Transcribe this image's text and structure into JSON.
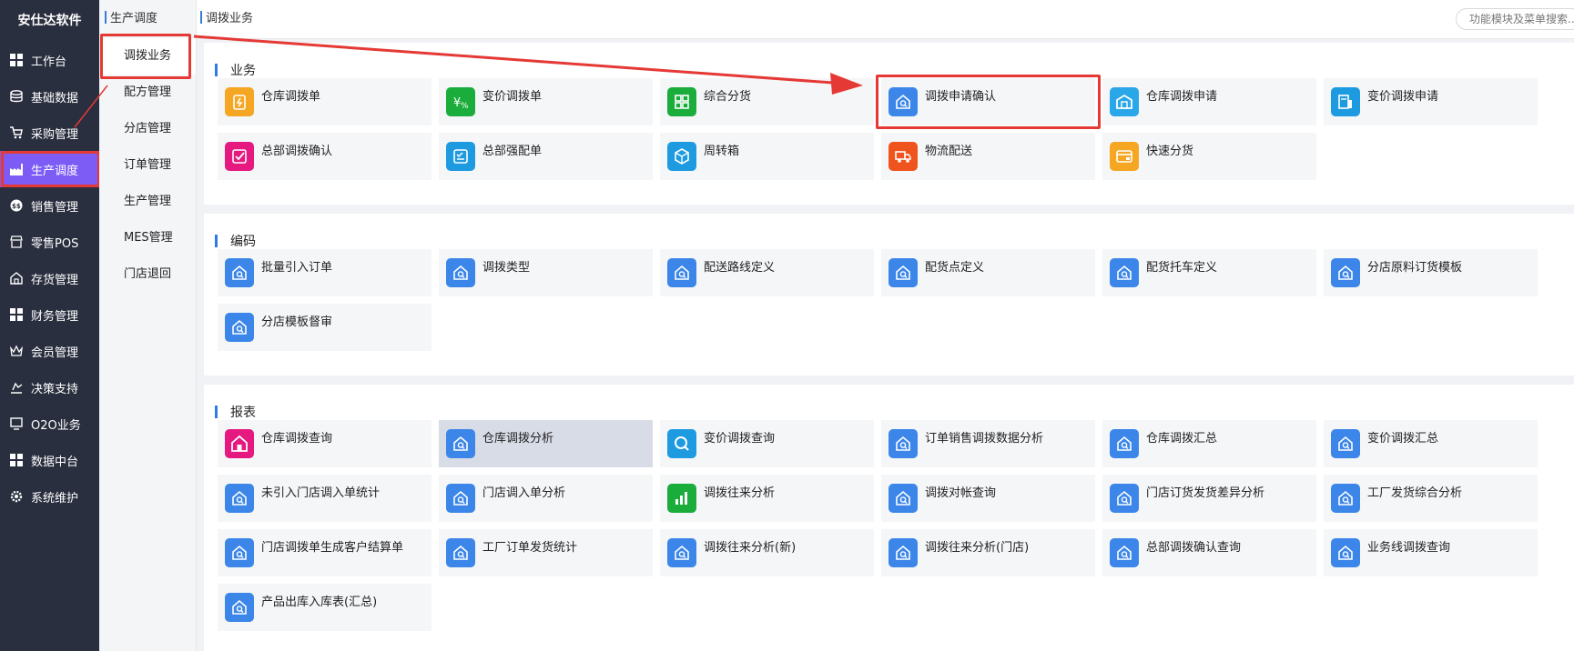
{
  "app": {
    "brand": "安仕达软件"
  },
  "sidebar": {
    "items": [
      {
        "label": "工作台",
        "icon": "grid-icon"
      },
      {
        "label": "基础数据",
        "icon": "database-icon"
      },
      {
        "label": "采购管理",
        "icon": "cart-icon"
      },
      {
        "label": "生产调度",
        "icon": "factory-icon",
        "active": true
      },
      {
        "label": "销售管理",
        "icon": "sales-icon"
      },
      {
        "label": "零售POS",
        "icon": "store-icon"
      },
      {
        "label": "存货管理",
        "icon": "warehouse-icon"
      },
      {
        "label": "财务管理",
        "icon": "grid-icon"
      },
      {
        "label": "会员管理",
        "icon": "crown-icon"
      },
      {
        "label": "决策支持",
        "icon": "decision-icon"
      },
      {
        "label": "O2O业务",
        "icon": "monitor-icon"
      },
      {
        "label": "数据中台",
        "icon": "grid-icon"
      },
      {
        "label": "系统维护",
        "icon": "gear-icon"
      }
    ]
  },
  "submenu": {
    "title": "生产调度",
    "items": [
      "调拨业务",
      "配方管理",
      "分店管理",
      "订单管理",
      "生产管理",
      "MES管理",
      "门店退回"
    ]
  },
  "topbar": {
    "breadcrumb": "调拨业务",
    "search_placeholder": "功能模块及菜单搜索..."
  },
  "sections": {
    "business": {
      "title": "业务",
      "cards": [
        {
          "label": "仓库调拨单",
          "icon": "clipboard-icon",
          "color": "#f5a623"
        },
        {
          "label": "变价调拨单",
          "icon": "price-tag-icon",
          "color": "#1aad3c"
        },
        {
          "label": "综合分货",
          "icon": "grid-icon",
          "color": "#1aad3c"
        },
        {
          "label": "调拨申请确认",
          "icon": "home-search-icon",
          "color": "#3b86e8"
        },
        {
          "label": "仓库调拨申请",
          "icon": "warehouse-icon",
          "color": "#2aa7e8"
        },
        {
          "label": "变价调拨申请",
          "icon": "document-icon",
          "color": "#1e9be0"
        },
        {
          "label": "总部调拨确认",
          "icon": "check-square-icon",
          "color": "#e5197f"
        },
        {
          "label": "总部强配单",
          "icon": "check-list-icon",
          "color": "#1e9be0"
        },
        {
          "label": "周转箱",
          "icon": "box-icon",
          "color": "#1e9be0"
        },
        {
          "label": "物流配送",
          "icon": "truck-icon",
          "color": "#f0541e"
        },
        {
          "label": "快速分货",
          "icon": "card-icon",
          "color": "#f5a623"
        }
      ]
    },
    "coding": {
      "title": "编码",
      "cards": [
        {
          "label": "批量引入订单",
          "icon": "home-search-icon",
          "color": "#3b86e8"
        },
        {
          "label": "调拨类型",
          "icon": "home-search-icon",
          "color": "#3b86e8"
        },
        {
          "label": "配送路线定义",
          "icon": "home-search-icon",
          "color": "#3b86e8"
        },
        {
          "label": "配货点定义",
          "icon": "home-search-icon",
          "color": "#3b86e8"
        },
        {
          "label": "配货托车定义",
          "icon": "home-search-icon",
          "color": "#3b86e8"
        },
        {
          "label": "分店原料订货模板",
          "icon": "home-search-icon",
          "color": "#3b86e8"
        },
        {
          "label": "分店模板督审",
          "icon": "home-search-icon",
          "color": "#3b86e8"
        }
      ]
    },
    "reports": {
      "title": "报表",
      "cards": [
        {
          "label": "仓库调拨查询",
          "icon": "home-icon",
          "color": "#e5197f"
        },
        {
          "label": "仓库调拨分析",
          "icon": "home-search-icon",
          "color": "#3b86e8"
        },
        {
          "label": "变价调拨查询",
          "icon": "magnifier-icon",
          "color": "#1e9be0"
        },
        {
          "label": "订单销售调拨数据分析",
          "icon": "home-search-icon",
          "color": "#3b86e8"
        },
        {
          "label": "仓库调拨汇总",
          "icon": "home-search-icon",
          "color": "#3b86e8"
        },
        {
          "label": "变价调拨汇总",
          "icon": "home-search-icon",
          "color": "#3b86e8"
        },
        {
          "label": "未引入门店调入单统计",
          "icon": "home-search-icon",
          "color": "#3b86e8"
        },
        {
          "label": "门店调入单分析",
          "icon": "home-search-icon",
          "color": "#3b86e8"
        },
        {
          "label": "调拨往来分析",
          "icon": "bar-chart-icon",
          "color": "#1aad3c"
        },
        {
          "label": "调拨对帐查询",
          "icon": "home-search-icon",
          "color": "#3b86e8"
        },
        {
          "label": "门店订货发货差异分析",
          "icon": "home-search-icon",
          "color": "#3b86e8"
        },
        {
          "label": "工厂发货综合分析",
          "icon": "home-search-icon",
          "color": "#3b86e8"
        },
        {
          "label": "门店调拨单生成客户结算单",
          "icon": "home-search-icon",
          "color": "#3b86e8"
        },
        {
          "label": "工厂订单发货统计",
          "icon": "home-search-icon",
          "color": "#3b86e8"
        },
        {
          "label": "调拨往来分析(新)",
          "icon": "home-search-icon",
          "color": "#3b86e8"
        },
        {
          "label": "调拨往来分析(门店)",
          "icon": "home-search-icon",
          "color": "#3b86e8"
        },
        {
          "label": "总部调拨确认查询",
          "icon": "home-search-icon",
          "color": "#3b86e8"
        },
        {
          "label": "业务线调拨查询",
          "icon": "home-search-icon",
          "color": "#3b86e8"
        },
        {
          "label": "产品出库入库表(汇总)",
          "icon": "home-search-icon",
          "color": "#3b86e8"
        }
      ]
    }
  },
  "colors": {
    "accent": "#7d5cf5",
    "sidebar_bg": "#2a2f3f",
    "annotation": "#e53935"
  }
}
